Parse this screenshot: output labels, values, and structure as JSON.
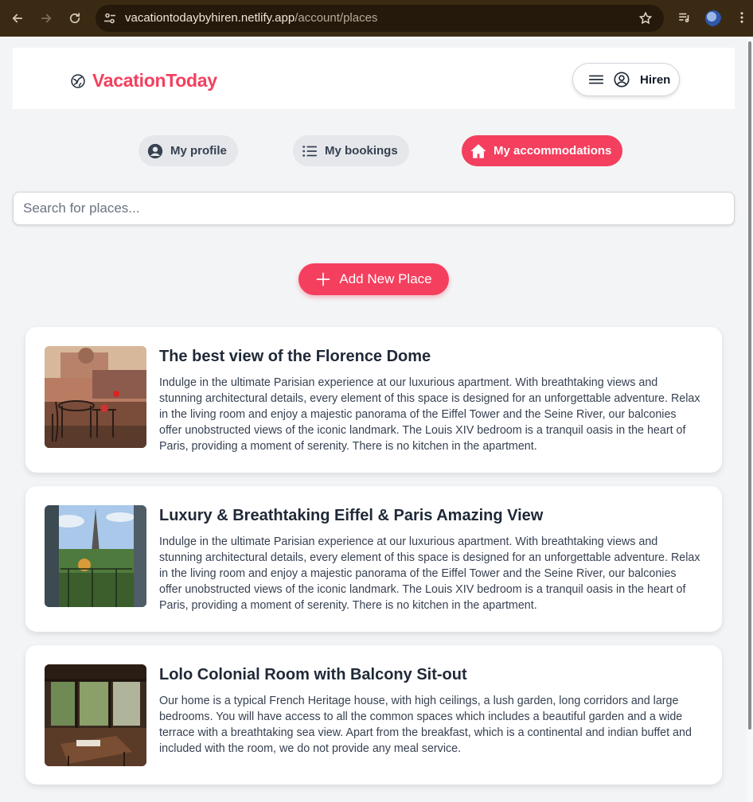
{
  "browser": {
    "url_domain": "vacationtodaybyhiren.netlify.app",
    "url_path": "/account/places"
  },
  "header": {
    "brand": "VacationToday",
    "user_name": "Hiren"
  },
  "tabs": [
    {
      "label": "My profile",
      "icon": "user-circle-icon",
      "active": false
    },
    {
      "label": "My bookings",
      "icon": "list-icon",
      "active": false
    },
    {
      "label": "My accommodations",
      "icon": "home-icon",
      "active": true
    }
  ],
  "search": {
    "placeholder": "Search for places...",
    "value": ""
  },
  "add_button": {
    "label": "Add New Place"
  },
  "places": [
    {
      "title": "The best view of the Florence Dome",
      "description": "Indulge in the ultimate Parisian experience at our luxurious apartment. With breathtaking views and stunning architectural details, every element of this space is designed for an unforgettable adventure. Relax in the living room and enjoy a majestic panorama of the Eiffel Tower and the Seine River, our balconies offer unobstructed views of the iconic landmark. The Louis XIV bedroom is a tranquil oasis in the heart of Paris, providing a moment of serenity. There is no kitchen in the apartment."
    },
    {
      "title": "Luxury & Breathtaking Eiffel & Paris Amazing View",
      "description": "Indulge in the ultimate Parisian experience at our luxurious apartment. With breathtaking views and stunning architectural details, every element of this space is designed for an unforgettable adventure. Relax in the living room and enjoy a majestic panorama of the Eiffel Tower and the Seine River, our balconies offer unobstructed views of the iconic landmark. The Louis XIV bedroom is a tranquil oasis in the heart of Paris, providing a moment of serenity. There is no kitchen in the apartment."
    },
    {
      "title": "Lolo Colonial Room with Balcony Sit-out",
      "description": "Our home is a typical French Heritage house, with high ceilings, a lush garden, long corridors and large bedrooms. You will have access to all the common spaces which includes a beautiful garden and a wide terrace with a breathtaking sea view. Apart from the breakfast, which is a continental and indian buffet and included with the room, we do not provide any meal service."
    }
  ],
  "colors": {
    "accent": "#f43f5e",
    "page_bg": "#f3f4f6",
    "chrome_bg": "#3b2a13"
  }
}
